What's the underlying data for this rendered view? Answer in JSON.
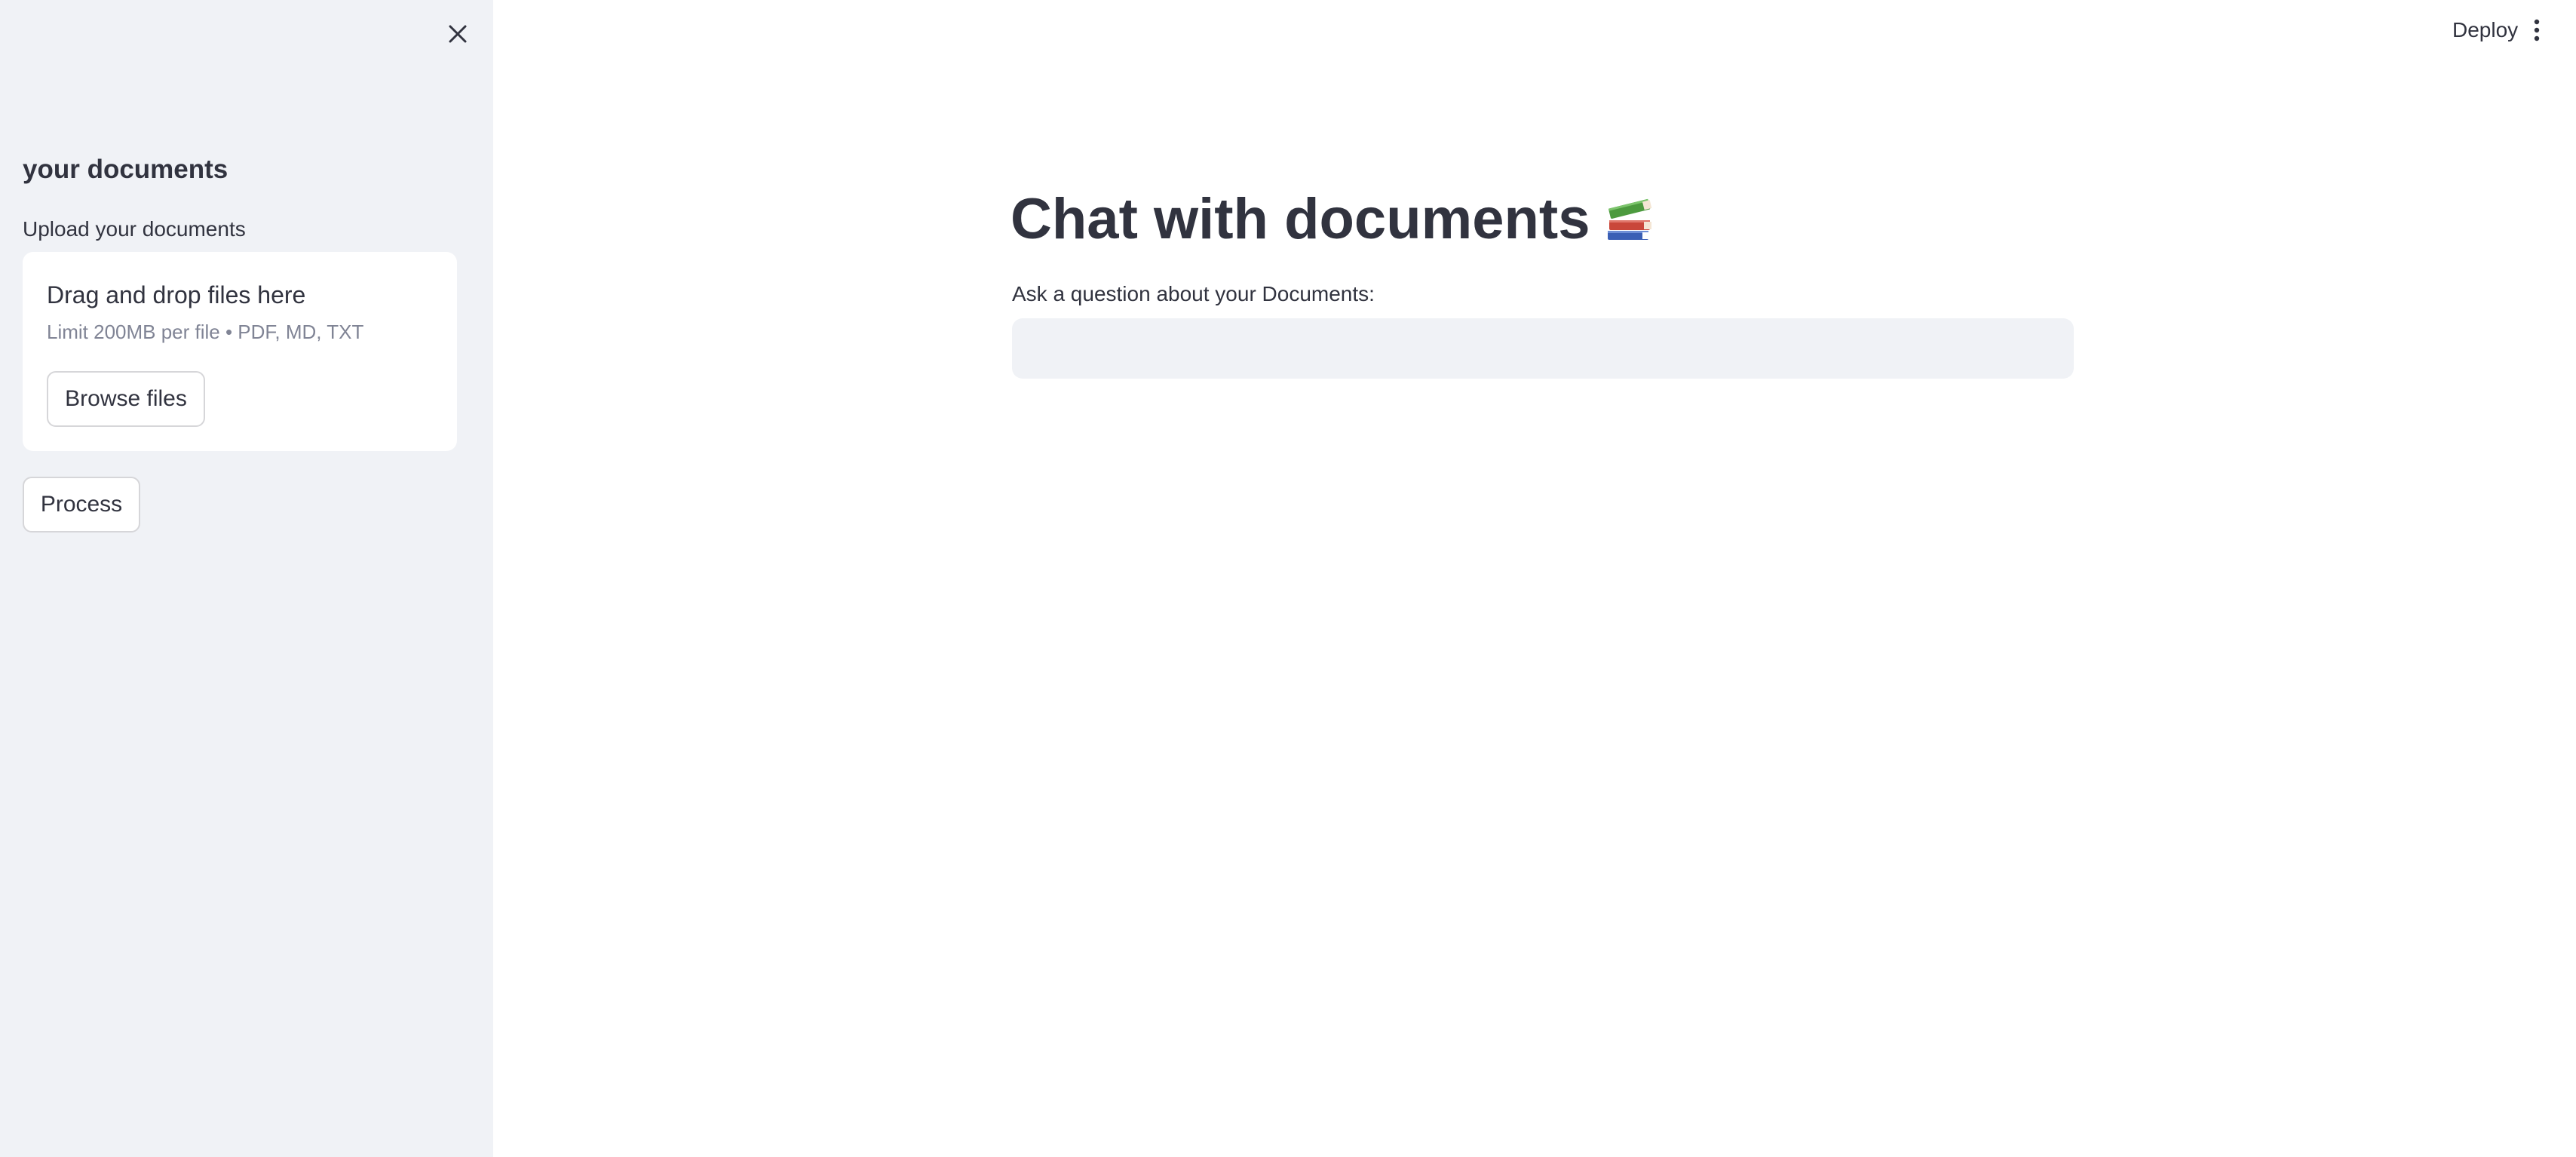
{
  "sidebar": {
    "title": "your documents",
    "upload_label": "Upload your documents",
    "dropzone": {
      "title": "Drag and drop files here",
      "limit": "Limit 200MB per file • PDF, MD, TXT",
      "browse_label": "Browse files"
    },
    "process_label": "Process",
    "close_icon": "close-icon"
  },
  "header": {
    "deploy_label": "Deploy",
    "menu_icon": "more-vertical-icon"
  },
  "main": {
    "title": "Chat with documents",
    "title_icon": "books-icon",
    "question_label": "Ask a question about your Documents:",
    "question_value": "",
    "question_placeholder": ""
  },
  "colors": {
    "sidebar_bg": "#f0f2f6",
    "text": "#31333f",
    "muted_text": "#808495",
    "input_bg": "#f0f2f6",
    "button_border": "#d6d6d9"
  }
}
